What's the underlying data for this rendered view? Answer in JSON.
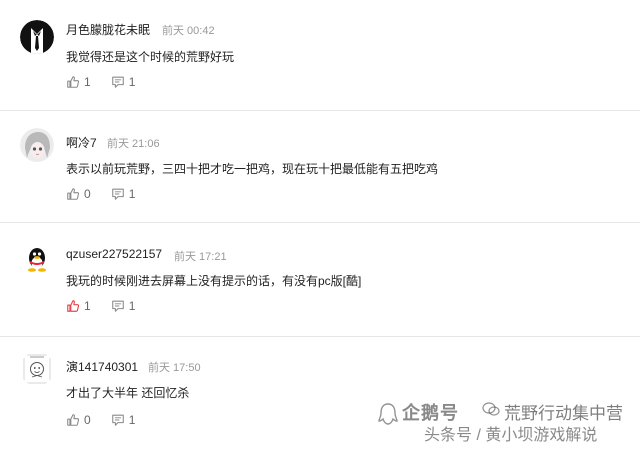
{
  "comments": [
    {
      "username": "月色朦胧花未眠",
      "time": "前天 00:42",
      "text": "我觉得还是这个时候的荒野好玩",
      "likes": "1",
      "replies": "1",
      "avatar_icon": "tuxedo-avatar-icon",
      "liked": false
    },
    {
      "username": "啊冷7",
      "time": "前天 21:06",
      "text": "表示以前玩荒野，三四十把才吃一把鸡，现在玩十把最低能有五把吃鸡",
      "likes": "0",
      "replies": "1",
      "avatar_icon": "anime-girl-avatar-icon",
      "liked": false
    },
    {
      "username": "qzuser227522157",
      "time": "前天 17:21",
      "text": "我玩的时候刚进去屏幕上没有提示的话，有没有pc版[酷]",
      "likes": "1",
      "replies": "1",
      "avatar_icon": "qq-penguin-avatar-icon",
      "liked": true
    },
    {
      "username": "演141740301",
      "time": "前天 17:50",
      "text": "才出了大半年 还回忆杀",
      "likes": "0",
      "replies": "1",
      "avatar_icon": "doodle-face-avatar-icon",
      "liked": false
    }
  ],
  "watermark": {
    "line1": "企鹅号",
    "brand": "荒野行动集中营",
    "line2": "头条号 / 黄小坝游戏解说"
  },
  "colors": {
    "liked_icon": "#e8474c",
    "default_icon": "#888888",
    "divider": "#e6e6e6",
    "time_text": "#999999"
  }
}
